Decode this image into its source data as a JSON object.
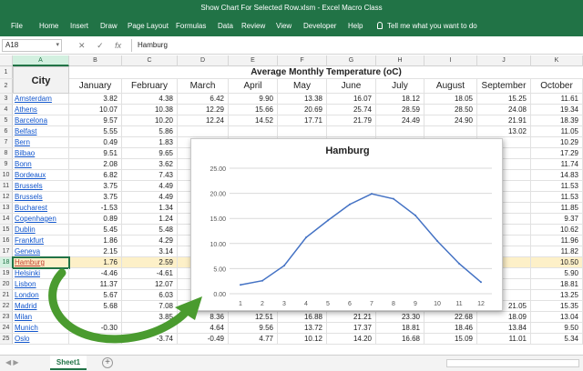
{
  "window": {
    "title": "Show Chart For Selected Row.xlsm  -  Excel Macro Class"
  },
  "ribbon": {
    "tabs": [
      "File",
      "Home",
      "Insert",
      "Draw",
      "Page Layout",
      "Formulas",
      "Data",
      "Review",
      "View",
      "Developer",
      "Help"
    ],
    "tell_me": "Tell me what you want to do"
  },
  "formula_bar": {
    "name_box": "A18",
    "cancel": "✕",
    "enter": "✓",
    "fx": "fx",
    "value": "Hamburg"
  },
  "columns": [
    "A",
    "B",
    "C",
    "D",
    "E",
    "F",
    "G",
    "H",
    "I",
    "J",
    "K"
  ],
  "selected_column": "A",
  "header": {
    "city": "City",
    "title": "Average Monthly Temperature (oC)",
    "months": [
      "January",
      "February",
      "March",
      "April",
      "May",
      "June",
      "July",
      "August",
      "September",
      "October"
    ]
  },
  "rows": [
    {
      "n": 3,
      "city": "Amsterdam",
      "v": [
        "3.82",
        "4.38",
        "6.42",
        "9.90",
        "13.38",
        "16.07",
        "18.12",
        "18.05",
        "15.25",
        "11.61"
      ]
    },
    {
      "n": 4,
      "city": "Athens",
      "v": [
        "10.07",
        "10.38",
        "12.29",
        "15.66",
        "20.69",
        "25.74",
        "28.59",
        "28.50",
        "24.08",
        "19.34"
      ]
    },
    {
      "n": 5,
      "city": "Barcelona",
      "v": [
        "9.57",
        "10.20",
        "12.24",
        "14.52",
        "17.71",
        "21.79",
        "24.49",
        "24.90",
        "21.91",
        "18.39"
      ]
    },
    {
      "n": 6,
      "city": "Belfast",
      "v": [
        "5.55",
        "5.86",
        "",
        "",
        "",
        "",
        "",
        "",
        "13.02",
        "11.05"
      ]
    },
    {
      "n": 7,
      "city": "Bern",
      "v": [
        "0.49",
        "1.83",
        "",
        "",
        "",
        "",
        "",
        "",
        "",
        "10.29"
      ]
    },
    {
      "n": 8,
      "city": "Bilbao",
      "v": [
        "9.51",
        "9.65",
        "",
        "",
        "",
        "",
        "",
        "",
        "",
        "17.29"
      ]
    },
    {
      "n": 9,
      "city": "Bonn",
      "v": [
        "2.08",
        "3.62",
        "",
        "",
        "",
        "",
        "",
        "",
        "",
        "11.74"
      ]
    },
    {
      "n": 10,
      "city": "Bordeaux",
      "v": [
        "6.82",
        "7.43",
        "",
        "",
        "",
        "",
        "",
        "",
        "",
        "14.83"
      ]
    },
    {
      "n": 11,
      "city": "Brussels",
      "v": [
        "3.75",
        "4.49",
        "",
        "",
        "",
        "",
        "",
        "",
        "",
        "11.53"
      ]
    },
    {
      "n": 12,
      "city": "Brussels",
      "v": [
        "3.75",
        "4.49",
        "",
        "",
        "",
        "",
        "",
        "",
        "",
        "11.53"
      ]
    },
    {
      "n": 13,
      "city": "Bucharest",
      "v": [
        "-1.53",
        "1.34",
        "",
        "",
        "",
        "",
        "",
        "",
        "",
        "11.85"
      ]
    },
    {
      "n": 14,
      "city": "Copenhagen",
      "v": [
        "0.89",
        "1.24",
        "",
        "",
        "",
        "",
        "",
        "",
        "",
        "9.37"
      ]
    },
    {
      "n": 15,
      "city": "Dublin",
      "v": [
        "5.45",
        "5.48",
        "",
        "",
        "",
        "",
        "",
        "",
        "",
        "10.62"
      ]
    },
    {
      "n": 16,
      "city": "Frankfurt",
      "v": [
        "1.86",
        "4.29",
        "",
        "",
        "",
        "",
        "",
        "",
        "",
        "11.96"
      ]
    },
    {
      "n": 17,
      "city": "Geneva",
      "v": [
        "2.15",
        "3.14",
        "",
        "",
        "",
        "",
        "",
        "",
        "",
        "11.82"
      ]
    },
    {
      "n": 18,
      "city": "Hamburg",
      "v": [
        "1.76",
        "2.59",
        "",
        "",
        "",
        "",
        "",
        "",
        "",
        "10.50"
      ]
    },
    {
      "n": 19,
      "city": "Helsinki",
      "v": [
        "-4.46",
        "-4.61",
        "",
        "",
        "",
        "",
        "",
        "",
        "",
        "5.90"
      ]
    },
    {
      "n": 20,
      "city": "Lisbon",
      "v": [
        "11.37",
        "12.07",
        "",
        "",
        "",
        "",
        "",
        "",
        "",
        "18.81"
      ]
    },
    {
      "n": 21,
      "city": "London",
      "v": [
        "5.67",
        "6.03",
        "",
        "",
        "",
        "",
        "",
        "",
        "",
        "13.25"
      ]
    },
    {
      "n": 22,
      "city": "Madrid",
      "v": [
        "5.68",
        "7.08",
        "",
        "13.11",
        "17.24",
        "23.17",
        "26.18",
        "25.66",
        "21.05",
        "15.35"
      ]
    },
    {
      "n": 23,
      "city": "Milan",
      "v": [
        "",
        "3.85",
        "8.36",
        "12.51",
        "16.88",
        "21.21",
        "23.30",
        "22.68",
        "18.09",
        "13.04"
      ]
    },
    {
      "n": 24,
      "city": "Munich",
      "v": [
        "-0.30",
        "",
        "4.64",
        "9.56",
        "13.72",
        "17.37",
        "18.81",
        "18.46",
        "13.84",
        "9.50"
      ]
    },
    {
      "n": 25,
      "city": "Oslo",
      "v": [
        "-4.44",
        "-3.74",
        "-0.49",
        "4.77",
        "10.12",
        "14.20",
        "16.68",
        "15.09",
        "11.01",
        "5.34"
      ]
    }
  ],
  "selected_row": 18,
  "chart_data": {
    "type": "line",
    "title": "Hamburg",
    "x": [
      1,
      2,
      3,
      4,
      5,
      6,
      7,
      8,
      9,
      10,
      11,
      12
    ],
    "series": [
      {
        "values": [
          1.76,
          2.59,
          5.6,
          11.2,
          14.6,
          17.8,
          19.9,
          18.9,
          15.6,
          10.5,
          6.0,
          2.3
        ]
      }
    ],
    "y_ticks": [
      "0.00",
      "5.00",
      "10.00",
      "15.00",
      "20.00",
      "25.00"
    ],
    "x_ticks": [
      "1",
      "2",
      "3",
      "4",
      "5",
      "6",
      "7",
      "8",
      "9",
      "10",
      "11",
      "12"
    ],
    "ylim": [
      0,
      25
    ],
    "grid": true,
    "line_color": "#4472c4"
  },
  "sheets": {
    "active": "Sheet1",
    "add": "+"
  },
  "colors": {
    "excel_green": "#217346",
    "highlight_row": "#fdf0c8",
    "arrow_green": "#4a9b2f"
  }
}
